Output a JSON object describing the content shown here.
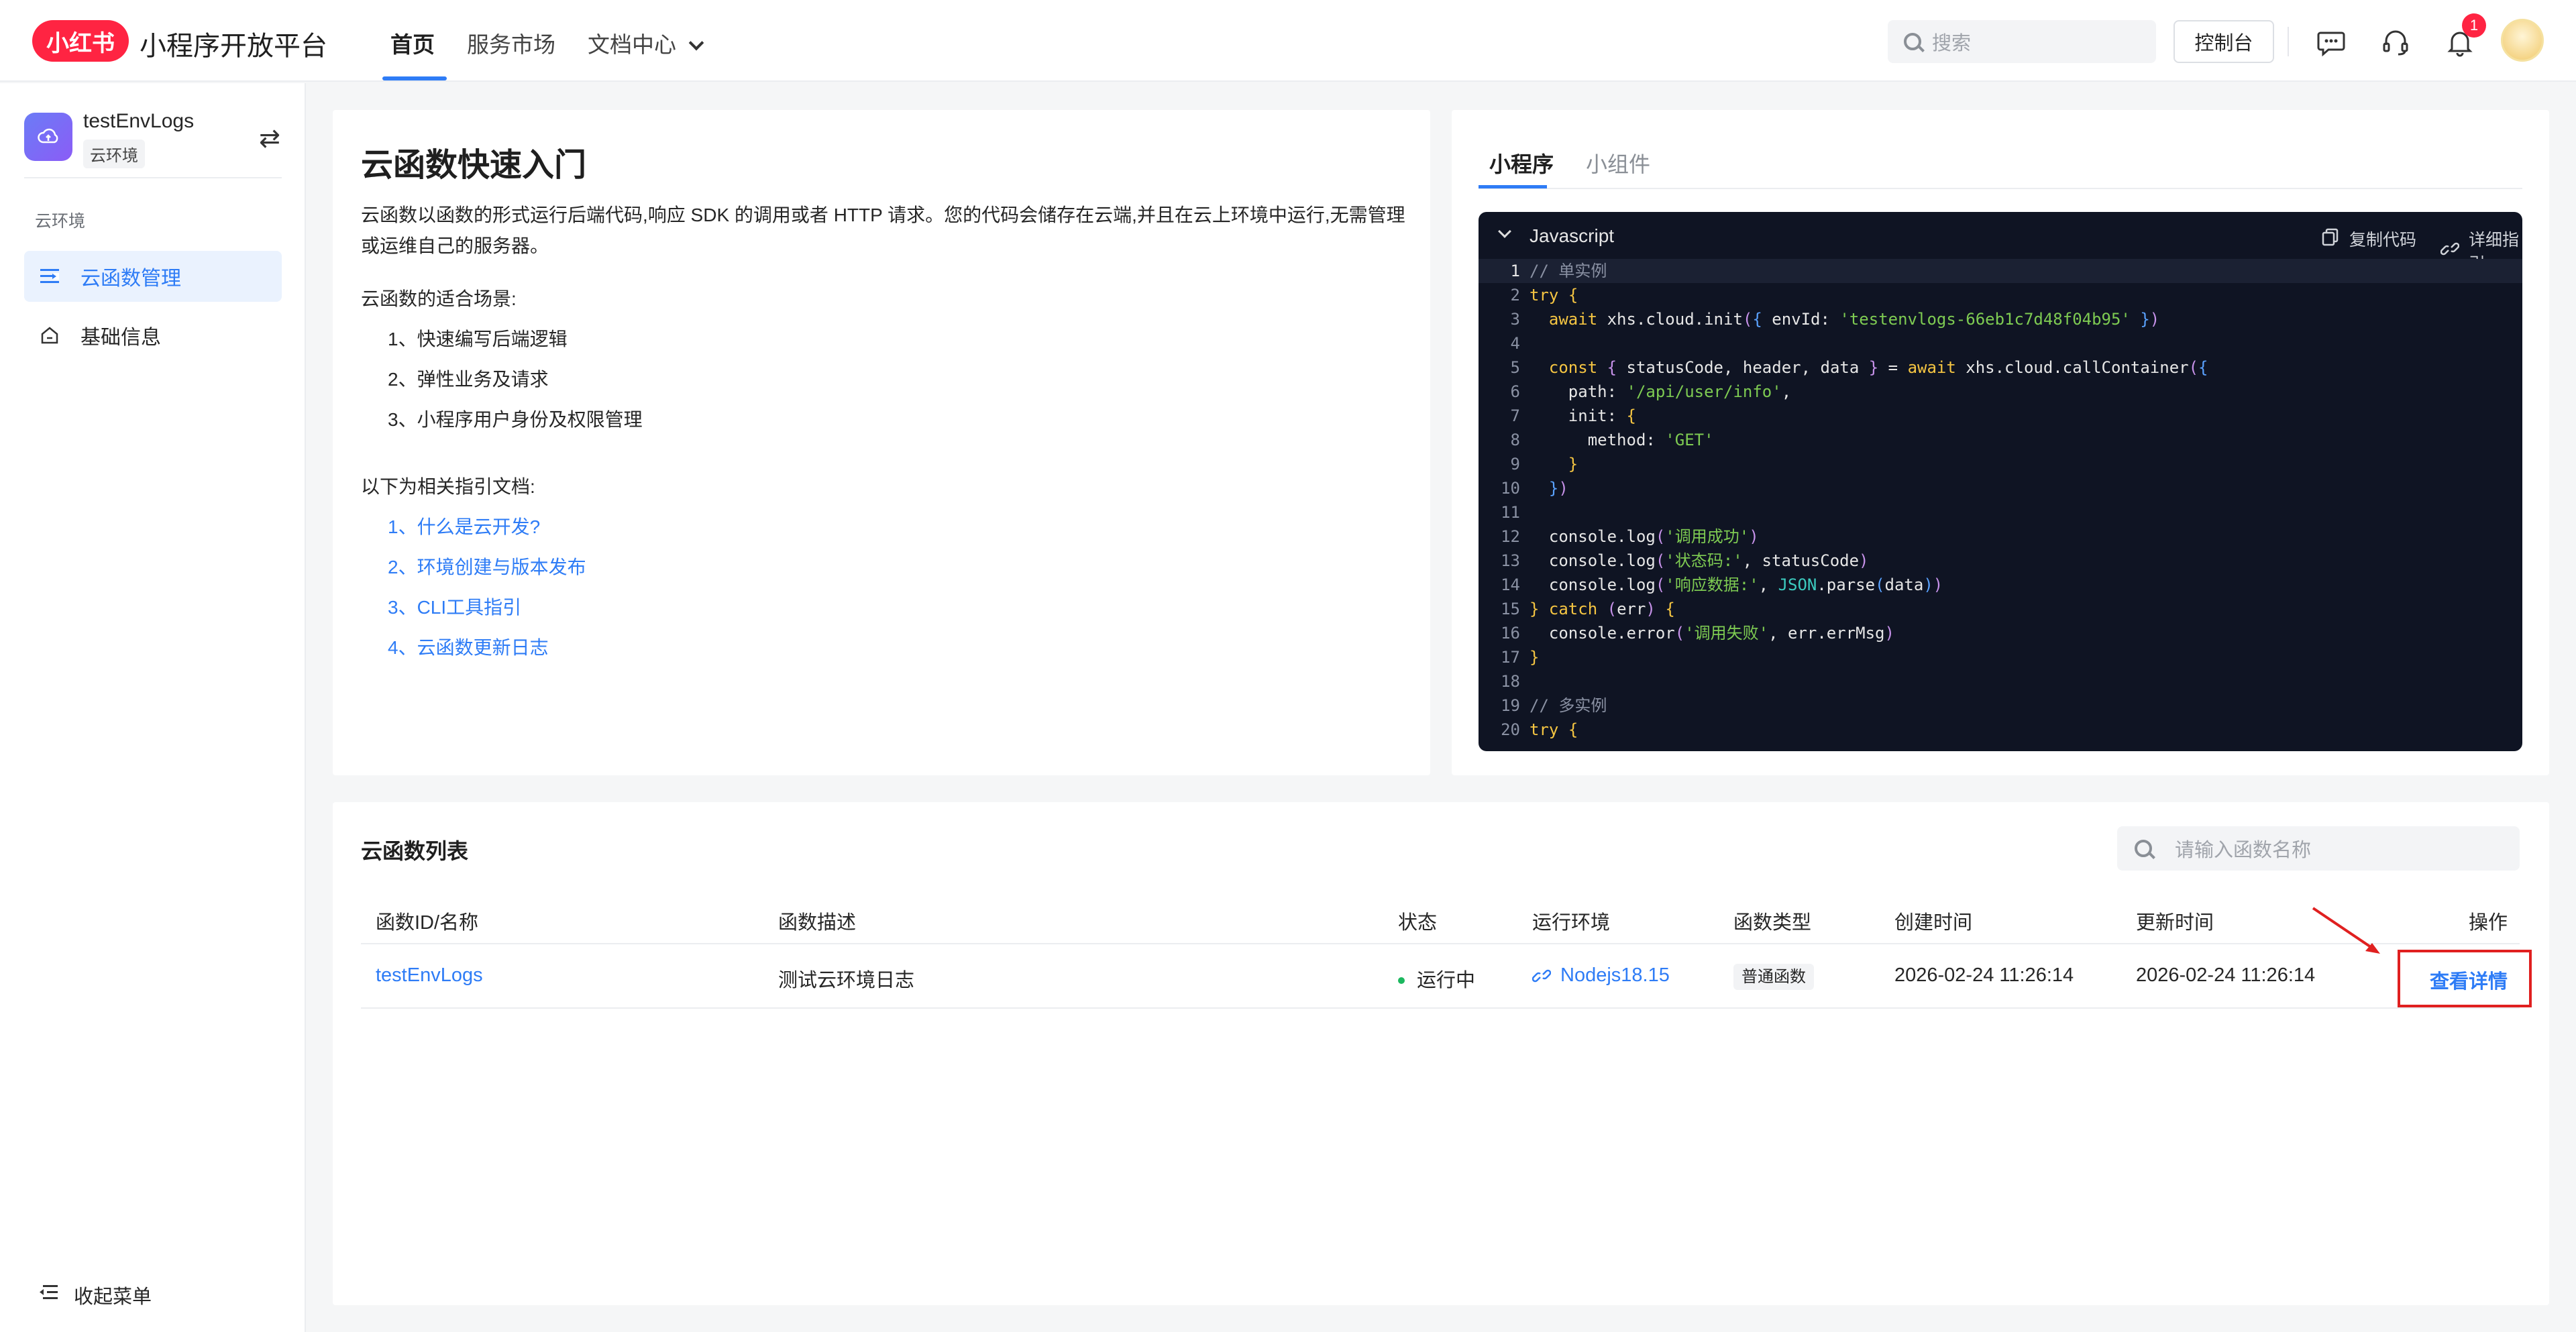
{
  "header": {
    "logo_text": "小红书",
    "platform_name": "小程序开放平台",
    "nav": [
      {
        "label": "首页",
        "active": true
      },
      {
        "label": "服务市场",
        "active": false
      },
      {
        "label": "文档中心",
        "active": false
      }
    ],
    "search_placeholder": "搜索",
    "console_label": "控制台",
    "notification_count": "1",
    "icons": [
      "chat-icon",
      "headset-icon",
      "bell-icon",
      "avatar"
    ]
  },
  "sidebar": {
    "env_name": "testEnvLogs",
    "env_tag": "云环境",
    "group_label": "云环境",
    "items": [
      {
        "label": "云函数管理",
        "icon": "list-icon",
        "active": true
      },
      {
        "label": "基础信息",
        "icon": "home-icon",
        "active": false
      }
    ],
    "collapse_label": "收起菜单"
  },
  "quickstart": {
    "title": "云函数快速入门",
    "desc": "云函数以函数的形式运行后端代码,响应 SDK 的调用或者 HTTP 请求。您的代码会储存在云端,并且在云上环境中运行,无需管理或运维自己的服务器。",
    "scenes_label": "云函数的适合场景:",
    "scenes": [
      "1、快速编写后端逻辑",
      "2、弹性业务及请求",
      "3、小程序用户身份及权限管理"
    ],
    "docs_label": "以下为相关指引文档:",
    "docs": [
      "1、什么是云开发?",
      "2、环境创建与版本发布",
      "3、CLI工具指引",
      "4、云函数更新日志"
    ]
  },
  "code_panel": {
    "tabs": [
      {
        "label": "小程序",
        "active": true
      },
      {
        "label": "小组件",
        "active": false
      }
    ],
    "language": "Javascript",
    "copy_label": "复制代码",
    "guide_label": "详细指引",
    "line_numbers": [
      "1",
      "2",
      "3",
      "4",
      "5",
      "6",
      "7",
      "8",
      "9",
      "10",
      "11",
      "12",
      "13",
      "14",
      "15",
      "16",
      "17",
      "18",
      "19",
      "20"
    ]
  },
  "function_list": {
    "title": "云函数列表",
    "search_placeholder": "请输入函数名称",
    "columns": [
      "函数ID/名称",
      "函数描述",
      "状态",
      "运行环境",
      "函数类型",
      "创建时间",
      "更新时间",
      "操作"
    ],
    "rows": [
      {
        "name": "testEnvLogs",
        "desc": "测试云环境日志",
        "status": "运行中",
        "status_color": "#1cb85f",
        "runtime": "Nodejs18.15",
        "type": "普通函数",
        "created": "2026-02-24 11:26:14",
        "updated": "2026-02-24 11:26:14",
        "action": "查看详情"
      }
    ]
  },
  "colors": {
    "brand": "#ff2442",
    "accent": "#2e7cf6",
    "code_bg": "#0f1423",
    "highlight_box": "#e02020"
  }
}
